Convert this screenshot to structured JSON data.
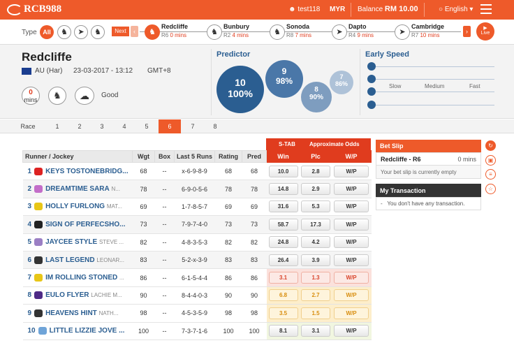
{
  "app": {
    "logo": "RCB988"
  },
  "header": {
    "username": "test118",
    "currency": "MYR",
    "balance_label": "Balance",
    "balance_value": "RM 10.00",
    "language": "English"
  },
  "race_nav": {
    "type_label": "Type",
    "all_label": "All",
    "next_label": "Next",
    "live_label": "Live",
    "races": [
      {
        "name": "Redcliffe",
        "race": "R6",
        "time": "0 mins"
      },
      {
        "name": "Bunbury",
        "race": "R2",
        "time": "4 mins"
      },
      {
        "name": "Sonoda",
        "race": "R8",
        "time": "7 mins"
      },
      {
        "name": "Dapto",
        "race": "R4",
        "time": "9 mins"
      },
      {
        "name": "Cambridge",
        "race": "R7",
        "time": "10 mins"
      }
    ]
  },
  "race_info": {
    "venue": "Redcliffe",
    "country": "AU (Har)",
    "datetime": "23-03-2017 - 13:12",
    "timezone": "GMT+8",
    "mins_value": "0",
    "mins_label": "mins",
    "condition": "Good"
  },
  "predictor": {
    "title": "Predictor",
    "bubbles": [
      {
        "num": "10",
        "pct": "100%",
        "value": 100
      },
      {
        "num": "9",
        "pct": "98%",
        "value": 98
      },
      {
        "num": "8",
        "pct": "90%",
        "value": 90
      },
      {
        "num": "7",
        "pct": "86%",
        "value": 86
      }
    ]
  },
  "early_speed": {
    "title": "Early Speed",
    "labels": [
      "Slow",
      "Medium",
      "Fast"
    ]
  },
  "race_tabs": {
    "label": "Race",
    "tabs": [
      "1",
      "2",
      "3",
      "4",
      "5",
      "6",
      "7",
      "8"
    ],
    "active": "6"
  },
  "table": {
    "stab_label": "S-TAB",
    "approx_label": "Approximate Odds",
    "headers": {
      "runner": "Runner / Jockey",
      "wgt": "Wgt",
      "box": "Box",
      "last5": "Last 5 Runs",
      "rating": "Rating",
      "pred": "Pred",
      "win": "Win",
      "plc": "Plc",
      "wp": "W/P"
    },
    "rows": [
      {
        "num": "1",
        "horse": "KEYS TOSTONEBRIDG...",
        "jockey": "",
        "wgt": "68",
        "box": "--",
        "last5": "x-6-9-8-9",
        "rating": "68",
        "pred": "68",
        "win": "10.0",
        "plc": "2.8",
        "wp": "W/P",
        "silk": "#d22"
      },
      {
        "num": "2",
        "horse": "DREAMTIME SARA",
        "jockey": "N...",
        "wgt": "78",
        "box": "--",
        "last5": "6-9-0-5-6",
        "rating": "78",
        "pred": "78",
        "win": "14.8",
        "plc": "2.9",
        "wp": "W/P",
        "silk": "#c36ec9"
      },
      {
        "num": "3",
        "horse": "HOLLY FURLONG",
        "jockey": "MAT...",
        "wgt": "69",
        "box": "--",
        "last5": "1-7-8-5-7",
        "rating": "69",
        "pred": "69",
        "win": "31.6",
        "plc": "5.3",
        "wp": "W/P",
        "silk": "#e8c617"
      },
      {
        "num": "4",
        "horse": "SIGN OF PERFECSHO...",
        "jockey": "",
        "wgt": "73",
        "box": "--",
        "last5": "7-9-7-4-0",
        "rating": "73",
        "pred": "73",
        "win": "58.7",
        "plc": "17.3",
        "wp": "W/P",
        "silk": "#222"
      },
      {
        "num": "5",
        "horse": "JAYCEE STYLE",
        "jockey": "STEVE ...",
        "wgt": "82",
        "box": "--",
        "last5": "4-8-3-5-3",
        "rating": "82",
        "pred": "82",
        "win": "24.8",
        "plc": "4.2",
        "wp": "W/P",
        "silk": "#9b7fc4"
      },
      {
        "num": "6",
        "horse": "LAST LEGEND",
        "jockey": "LEONAR...",
        "wgt": "83",
        "box": "--",
        "last5": "5-2-x-3-9",
        "rating": "83",
        "pred": "83",
        "win": "26.4",
        "plc": "3.9",
        "wp": "W/P",
        "silk": "#333"
      },
      {
        "num": "7",
        "horse": "IM ROLLING STONED",
        "jockey": "...",
        "wgt": "86",
        "box": "--",
        "last5": "6-1-5-4-4",
        "rating": "86",
        "pred": "86",
        "win": "3.1",
        "plc": "1.3",
        "wp": "W/P",
        "silk": "#e8c617"
      },
      {
        "num": "8",
        "horse": "EULO FLYER",
        "jockey": "LACHIE M...",
        "wgt": "90",
        "box": "--",
        "last5": "8-4-4-0-3",
        "rating": "90",
        "pred": "90",
        "win": "6.8",
        "plc": "2.7",
        "wp": "W/P",
        "silk": "#4e2a86"
      },
      {
        "num": "9",
        "horse": "HEAVENS HINT",
        "jockey": "NATH...",
        "wgt": "98",
        "box": "--",
        "last5": "4-5-3-5-9",
        "rating": "98",
        "pred": "98",
        "win": "3.5",
        "plc": "1.5",
        "wp": "W/P",
        "silk": "#333"
      },
      {
        "num": "10",
        "horse": "LITTLE LIZZIE JOVE ...",
        "jockey": "",
        "wgt": "100",
        "box": "--",
        "last5": "7-3-7-1-6",
        "rating": "100",
        "pred": "100",
        "win": "8.1",
        "plc": "3.1",
        "wp": "W/P",
        "silk": "#6fa4d8"
      }
    ]
  },
  "bet_slip": {
    "title": "Bet Slip",
    "race": "Redcliffe - R6",
    "mins": "0 mins",
    "empty_text": "Your bet slip is currently empty"
  },
  "transaction": {
    "title": "My Transaction",
    "dash": "-",
    "empty_text": "You don't have any transaction."
  },
  "colors": {
    "accent": "#ee5a2a",
    "odds_red": "#e03c1e",
    "navy": "#2b5e91"
  }
}
